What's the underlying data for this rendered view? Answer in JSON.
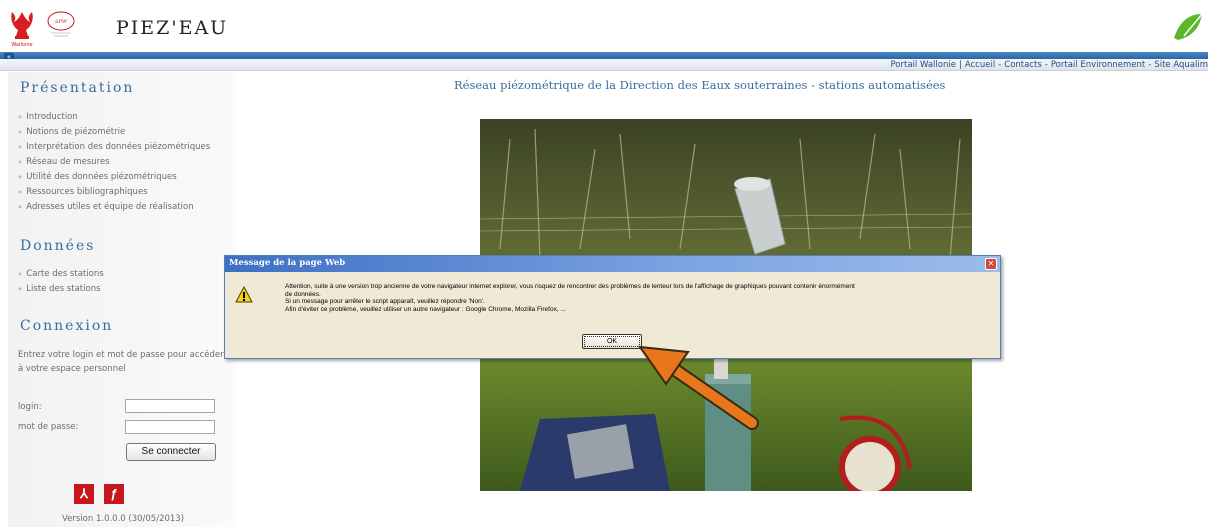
{
  "header": {
    "title": "PIEZ'EAU",
    "logo_wallonie_caption": "Wallonie",
    "logo_spw_caption": "SPW"
  },
  "topnav": {
    "links": [
      "Portail Wallonie",
      "Accueil",
      "Contacts",
      "Portail Environnement",
      "Site Aqualim"
    ]
  },
  "sidebar": {
    "presentation_title": "Présentation",
    "presentation_items": [
      "Introduction",
      "Notions de piézométrie",
      "Interprétation des données piézométriques",
      "Réseau de mesures",
      "Utilité des données piézométriques",
      "Ressources bibliographiques",
      "Adresses utiles et équipe de réalisation"
    ],
    "donnees_title": "Données",
    "donnees_items": [
      "Carte des stations",
      "Liste des stations"
    ],
    "connexion_title": "Connexion",
    "connexion_desc": "Entrez votre login et mot de passe pour accéder à votre espace personnel",
    "login_label": "login:",
    "password_label": "mot de passe:",
    "connect_button": "Se connecter",
    "version": "Version 1.0.0.0 (30/05/2013)"
  },
  "main": {
    "title": "Réseau piézométrique de la Direction des Eaux souterraines - stations automatisées"
  },
  "dialog": {
    "title": "Message de la page Web",
    "close": "✕",
    "lines": [
      "Attention, suite à une version trop ancienne de votre navigateur internet explorer, vous risquez de rencontrer des problèmes de lenteur lors de l'affichage de graphiques pouvant contenir énormément",
      "de données.",
      "Si un message pour arrêter le script apparaît, veuillez répondre 'Non'.",
      "Afin d'éviter ce problème, veuillez utiliser un autre navigateur : Google Chrome, Mozilla Firefox, ..."
    ],
    "ok_button": "OK"
  },
  "colors": {
    "accent_blue": "#3a6d9a",
    "bullet_green": "#7aa83a",
    "annotation_arrow": "#e8761c"
  },
  "icons": {
    "collapse": "collapse-icon",
    "warning": "warning-icon",
    "pdf": "pdf-icon",
    "flash": "flash-icon"
  }
}
